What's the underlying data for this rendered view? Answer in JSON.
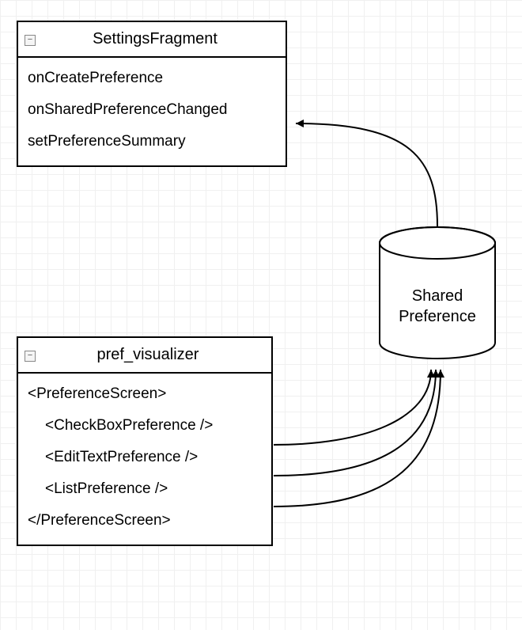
{
  "box1": {
    "title": "SettingsFragment",
    "items": [
      "onCreatePreference",
      "onSharedPreferenceChanged",
      "setPreferenceSummary"
    ]
  },
  "box2": {
    "title": "pref_visualizer",
    "open": "<PreferenceScreen>",
    "items": [
      "<CheckBoxPreference />",
      "<EditTextPreference />",
      "<ListPreference />"
    ],
    "close": "</PreferenceScreen>"
  },
  "cylinder": {
    "line1": "Shared",
    "line2": "Preference"
  },
  "icons": {
    "collapse": "−"
  }
}
